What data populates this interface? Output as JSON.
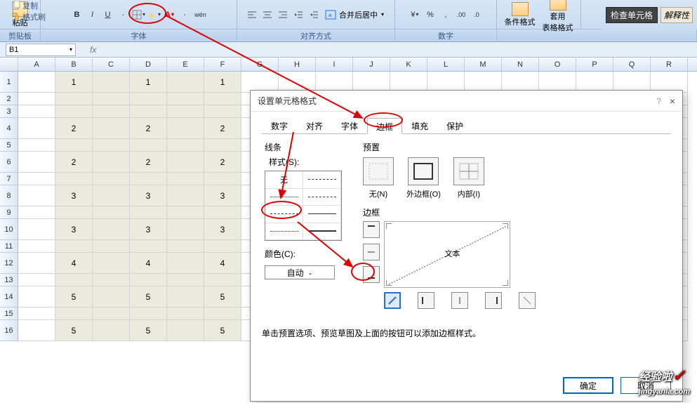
{
  "ribbon": {
    "copy": "复制",
    "paste": "粘贴",
    "format_painter": "格式刷",
    "bold": "B",
    "italic": "I",
    "underline": "U",
    "wen": "wén",
    "merge_center": "合并后居中",
    "conditional_format": "条件格式",
    "table_style": "套用\n表格格式",
    "check_cell": "检查单元格",
    "explain": "解释性"
  },
  "group_labels": {
    "clipboard": "剪贴板",
    "font": "字体",
    "align": "对齐方式",
    "number": "数字"
  },
  "name_box": "B1",
  "fx": "fx",
  "columns": [
    "A",
    "B",
    "C",
    "D",
    "E",
    "F",
    "G",
    "H",
    "I",
    "J",
    "K",
    "L",
    "M",
    "N",
    "O",
    "P",
    "Q",
    "R"
  ],
  "rows": [
    {
      "n": "1",
      "cells": [
        "",
        "1",
        "",
        "1",
        "",
        "1",
        "",
        "",
        "",
        "",
        "",
        "",
        "",
        "",
        "",
        "",
        "",
        ""
      ]
    },
    {
      "n": "2",
      "cells": [
        "",
        "",
        "",
        "",
        "",
        "",
        "",
        "",
        "",
        "",
        "",
        "",
        "",
        "",
        "",
        "",
        "",
        ""
      ]
    },
    {
      "n": "3",
      "cells": [
        "",
        "",
        "",
        "",
        "",
        "",
        "",
        "",
        "",
        "",
        "",
        "",
        "",
        "",
        "",
        "",
        "",
        ""
      ]
    },
    {
      "n": "4",
      "cells": [
        "",
        "2",
        "",
        "2",
        "",
        "2",
        "",
        "",
        "",
        "",
        "",
        "",
        "",
        "",
        "",
        "",
        "",
        ""
      ]
    },
    {
      "n": "5",
      "cells": [
        "",
        "",
        "",
        "",
        "",
        "",
        "",
        "",
        "",
        "",
        "",
        "",
        "",
        "",
        "",
        "",
        "",
        ""
      ]
    },
    {
      "n": "6",
      "cells": [
        "",
        "2",
        "",
        "2",
        "",
        "2",
        "",
        "",
        "",
        "",
        "",
        "",
        "",
        "",
        "",
        "",
        "",
        ""
      ]
    },
    {
      "n": "7",
      "cells": [
        "",
        "",
        "",
        "",
        "",
        "",
        "",
        "",
        "",
        "",
        "",
        "",
        "",
        "",
        "",
        "",
        "",
        ""
      ]
    },
    {
      "n": "8",
      "cells": [
        "",
        "3",
        "",
        "3",
        "",
        "3",
        "",
        "",
        "",
        "",
        "",
        "",
        "",
        "",
        "",
        "",
        "",
        ""
      ]
    },
    {
      "n": "9",
      "cells": [
        "",
        "",
        "",
        "",
        "",
        "",
        "",
        "",
        "",
        "",
        "",
        "",
        "",
        "",
        "",
        "",
        "",
        ""
      ]
    },
    {
      "n": "10",
      "cells": [
        "",
        "3",
        "",
        "3",
        "",
        "3",
        "",
        "",
        "",
        "",
        "",
        "",
        "",
        "",
        "",
        "",
        "",
        ""
      ]
    },
    {
      "n": "11",
      "cells": [
        "",
        "",
        "",
        "",
        "",
        "",
        "",
        "",
        "",
        "",
        "",
        "",
        "",
        "",
        "",
        "",
        "",
        ""
      ]
    },
    {
      "n": "12",
      "cells": [
        "",
        "4",
        "",
        "4",
        "",
        "4",
        "",
        "",
        "",
        "",
        "",
        "",
        "",
        "",
        "",
        "",
        "",
        ""
      ]
    },
    {
      "n": "13",
      "cells": [
        "",
        "",
        "",
        "",
        "",
        "",
        "",
        "",
        "",
        "",
        "",
        "",
        "",
        "",
        "",
        "",
        "",
        ""
      ]
    },
    {
      "n": "14",
      "cells": [
        "",
        "5",
        "",
        "5",
        "",
        "5",
        "",
        "",
        "",
        "",
        "",
        "",
        "",
        "",
        "",
        "",
        "",
        ""
      ]
    },
    {
      "n": "15",
      "cells": [
        "",
        "",
        "",
        "",
        "",
        "",
        "",
        "",
        "",
        "",
        "",
        "",
        "",
        "",
        "",
        "",
        "",
        ""
      ]
    },
    {
      "n": "16",
      "cells": [
        "",
        "5",
        "",
        "5",
        "",
        "5",
        "",
        "",
        "",
        "",
        "",
        "",
        "",
        "",
        "",
        "",
        "",
        ""
      ]
    }
  ],
  "dialog": {
    "title": "设置单元格格式",
    "help": "?",
    "close": "×",
    "tabs": [
      "数字",
      "对齐",
      "字体",
      "边框",
      "填充",
      "保护"
    ],
    "active_tab": 3,
    "line_section": "线条",
    "style_label": "样式(S):",
    "style_none": "无",
    "color_label": "颜色(C):",
    "color_auto": "自动",
    "preset_section": "预置",
    "presets": [
      {
        "label": "无(N)"
      },
      {
        "label": "外边框(O)"
      },
      {
        "label": "内部(I)"
      }
    ],
    "border_section": "边框",
    "preview_text": "文本",
    "hint": "单击预置选项、预览草图及上面的按钮可以添加边框样式。",
    "ok": "确定",
    "cancel": "取消"
  },
  "watermark": {
    "t1": "经验啦",
    "t2": "jingyanla.com",
    "check": "✓"
  }
}
